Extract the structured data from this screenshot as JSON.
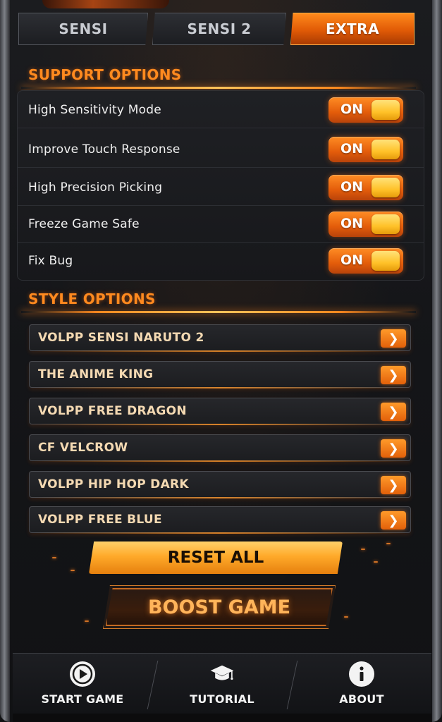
{
  "tabs": [
    {
      "label": "SENSI",
      "active": false
    },
    {
      "label": "SENSI 2",
      "active": false
    },
    {
      "label": "EXTRA",
      "active": true
    }
  ],
  "support": {
    "title": "SUPPORT OPTIONS",
    "options": [
      {
        "label": "High Sensitivity Mode",
        "state": "ON"
      },
      {
        "label": "Improve Touch Response",
        "state": "ON"
      },
      {
        "label": "High Precision Picking",
        "state": "ON"
      },
      {
        "label": "Freeze Game Safe",
        "state": "ON"
      },
      {
        "label": "Fix Bug",
        "state": "ON"
      }
    ]
  },
  "style": {
    "title": "STYLE OPTIONS",
    "options": [
      {
        "label": "VOLPP SENSI NARUTO 2"
      },
      {
        "label": "THE ANIME KING"
      },
      {
        "label": "VOLPP FREE DRAGON"
      },
      {
        "label": "CF VELCROW"
      },
      {
        "label": "VOLPP HIP HOP DARK"
      },
      {
        "label": "VOLPP FREE BLUE"
      }
    ],
    "arrow_icon": "chevron-right-icon"
  },
  "actions": {
    "reset_label": "RESET ALL",
    "boost_label": "BOOST GAME"
  },
  "nav": [
    {
      "label": "START GAME",
      "icon": "play-icon"
    },
    {
      "label": "TUTORIAL",
      "icon": "graduation-cap-icon"
    },
    {
      "label": "ABOUT",
      "icon": "info-icon"
    }
  ],
  "colors": {
    "accent": "#ff8a1f",
    "toggle_knob": "#ffc229",
    "background": "#141518"
  }
}
